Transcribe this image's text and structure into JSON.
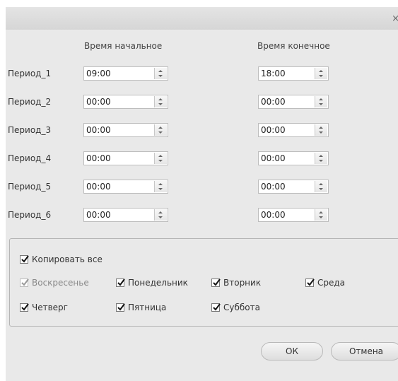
{
  "dialog": {
    "close_glyph": "×"
  },
  "headers": {
    "start": "Время начальное",
    "end": "Время конечное"
  },
  "periods": [
    {
      "label": "Период_1",
      "start": "09:00",
      "end": "18:00"
    },
    {
      "label": "Период_2",
      "start": "00:00",
      "end": "00:00"
    },
    {
      "label": "Период_3",
      "start": "00:00",
      "end": "00:00"
    },
    {
      "label": "Период_4",
      "start": "00:00",
      "end": "00:00"
    },
    {
      "label": "Период_5",
      "start": "00:00",
      "end": "00:00"
    },
    {
      "label": "Период_6",
      "start": "00:00",
      "end": "00:00"
    }
  ],
  "copy_all": {
    "label": "Копировать все",
    "checked": true
  },
  "days": [
    {
      "label": "Воскресенье",
      "checked": true,
      "enabled": false
    },
    {
      "label": "Понедельник",
      "checked": true,
      "enabled": true
    },
    {
      "label": "Вторник",
      "checked": true,
      "enabled": true
    },
    {
      "label": "Среда",
      "checked": true,
      "enabled": true
    },
    {
      "label": "Четверг",
      "checked": true,
      "enabled": true
    },
    {
      "label": "Пятница",
      "checked": true,
      "enabled": true
    },
    {
      "label": "Суббота",
      "checked": true,
      "enabled": true
    }
  ],
  "buttons": {
    "ok": "ОК",
    "cancel": "Отмена"
  }
}
